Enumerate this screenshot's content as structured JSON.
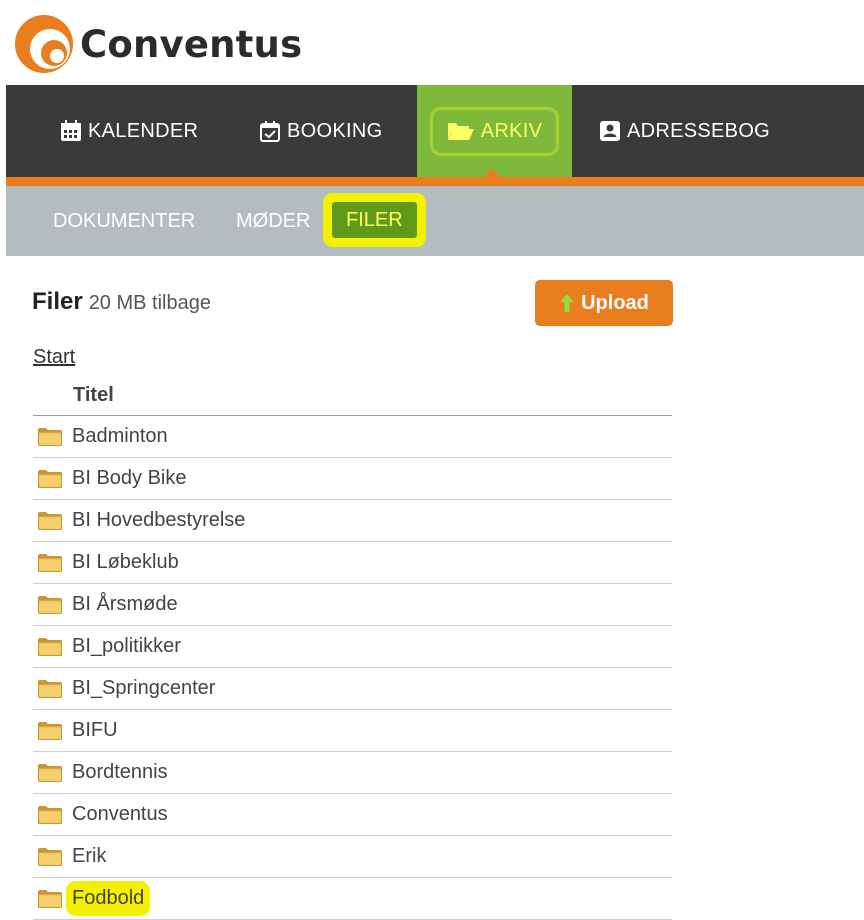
{
  "brand": {
    "name": "Conventus",
    "orange": "#e87e1e",
    "green": "#7fb93b"
  },
  "main_nav": [
    {
      "label": "KALENDER",
      "icon": "calendar-icon"
    },
    {
      "label": "BOOKING",
      "icon": "calendar-check-icon"
    },
    {
      "label": "ARKIV",
      "icon": "folder-open-icon",
      "active": true
    },
    {
      "label": "ADRESSEBOG",
      "icon": "contact-card-icon"
    }
  ],
  "sub_nav": [
    {
      "label": "DOKUMENTER"
    },
    {
      "label": "MØDER"
    },
    {
      "label": "FILER",
      "active": true
    }
  ],
  "header": {
    "title": "Filer",
    "storage": "20 MB tilbage",
    "upload_label": "Upload",
    "upload_icon": "arrow-up-icon"
  },
  "breadcrumb": {
    "start": "Start"
  },
  "table": {
    "column": "Titel",
    "rows": [
      "Badminton",
      "BI Body Bike",
      "BI Hovedbestyrelse",
      "BI Løbeklub",
      "BI Årsmøde",
      "BI_politikker",
      "BI_Springcenter",
      "BIFU",
      "Bordtennis",
      "Conventus",
      "Erik",
      "Fodbold"
    ],
    "row_icon": "folder-icon",
    "highlighted_row": "Fodbold"
  }
}
